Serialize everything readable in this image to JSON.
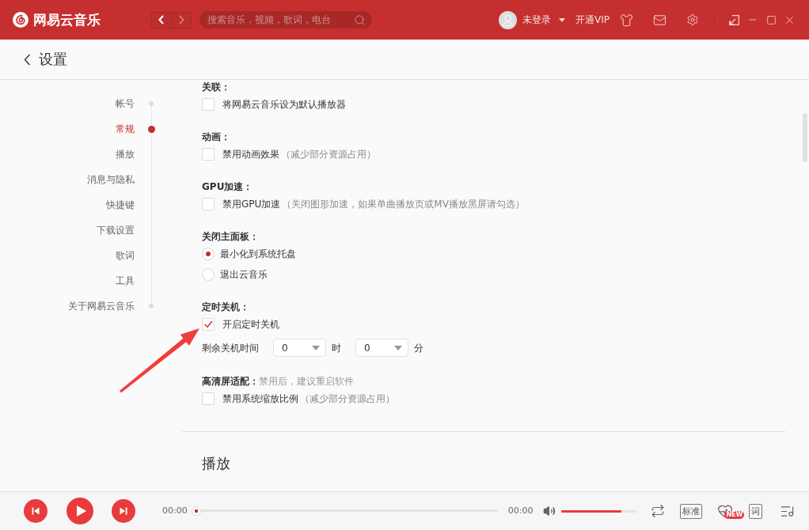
{
  "title_bar": {
    "app_name": "网易云音乐",
    "nav": [
      {
        "kind": "back",
        "disabled": false
      },
      {
        "kind": "forward",
        "disabled": true
      }
    ],
    "search": {
      "placeholder": "搜索音乐，视频，歌词，电台"
    },
    "user": {
      "name": "未登录"
    },
    "vip": "开通VIP"
  },
  "page_header": {
    "title": "设置"
  },
  "sidebar": {
    "items": [
      {
        "label": "帐号",
        "selected": false
      },
      {
        "label": "常规",
        "selected": true
      },
      {
        "label": "播放",
        "selected": false
      },
      {
        "label": "消息与隐私",
        "selected": false
      },
      {
        "label": "快捷键",
        "selected": false
      },
      {
        "label": "下载设置",
        "selected": false
      },
      {
        "label": "歌词",
        "selected": false
      },
      {
        "label": "工具",
        "selected": false
      },
      {
        "label": "关于网易云音乐",
        "selected": false
      }
    ]
  },
  "sections": [
    {
      "title": "关联：",
      "options": [
        {
          "kind": "checkbox",
          "label": "将网易云音乐设为默认播放器",
          "checked": false
        }
      ]
    },
    {
      "title": "动画：",
      "options": [
        {
          "kind": "checkbox",
          "label": "禁用动画效果",
          "note": "（减少部分资源占用）",
          "checked": false
        }
      ]
    },
    {
      "title": "GPU加速：",
      "options": [
        {
          "kind": "checkbox",
          "label": "禁用GPU加速",
          "note": "（关闭图形加速，如果单曲播放页或MV播放黑屏请勾选）",
          "checked": false
        }
      ]
    },
    {
      "title": "关闭主面板：",
      "options": [
        {
          "kind": "radio",
          "label": "最小化到系统托盘",
          "selected": true
        },
        {
          "kind": "radio",
          "label": "退出云音乐",
          "selected": false
        }
      ]
    },
    {
      "title": "定时关机：",
      "options": [
        {
          "kind": "checkbox",
          "label": "开启定时关机",
          "checked": true
        },
        {
          "kind": "timer",
          "label": "剩余关机时间",
          "selects": [
            {
              "value": "0",
              "unit": "时"
            },
            {
              "value": "0",
              "unit": "分"
            }
          ]
        }
      ]
    },
    {
      "title": "高清屏适配：",
      "hint": "禁用后，建议重启软件",
      "options": [
        {
          "kind": "checkbox",
          "label": "禁用系统缩放比例",
          "note": "（减少部分资源占用）",
          "checked": false
        }
      ]
    }
  ],
  "next_section": {
    "title": "播放"
  },
  "player": {
    "elapsed": "00:00",
    "progress": {
      "level": 0
    },
    "duration": "00:00",
    "volume": {
      "level": 0.8
    },
    "quality": "标准",
    "effects_badge": "NEW",
    "lyrics": "词"
  }
}
